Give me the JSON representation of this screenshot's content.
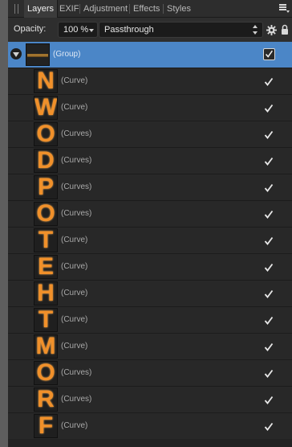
{
  "tabs": [
    {
      "label": "Layers",
      "active": true
    },
    {
      "label": "EXIF",
      "active": false
    },
    {
      "label": "Adjustment",
      "active": false
    },
    {
      "label": "Effects",
      "active": false
    },
    {
      "label": "Styles",
      "active": false
    }
  ],
  "toolbar": {
    "opacity_label": "Opacity:",
    "opacity_value": "100 %",
    "blend_mode": "Passthrough"
  },
  "group": {
    "name": "(Group)",
    "visible": true
  },
  "layers": [
    {
      "letter": "N",
      "name": "(Curve)",
      "visible": true
    },
    {
      "letter": "W",
      "name": "(Curve)",
      "visible": true
    },
    {
      "letter": "O",
      "name": "(Curves)",
      "visible": true
    },
    {
      "letter": "D",
      "name": "(Curves)",
      "visible": true
    },
    {
      "letter": "P",
      "name": "(Curves)",
      "visible": true
    },
    {
      "letter": "O",
      "name": "(Curves)",
      "visible": true
    },
    {
      "letter": "T",
      "name": "(Curve)",
      "visible": true
    },
    {
      "letter": "E",
      "name": "(Curve)",
      "visible": true
    },
    {
      "letter": "H",
      "name": "(Curve)",
      "visible": true
    },
    {
      "letter": "T",
      "name": "(Curve)",
      "visible": true
    },
    {
      "letter": "M",
      "name": "(Curve)",
      "visible": true
    },
    {
      "letter": "O",
      "name": "(Curves)",
      "visible": true
    },
    {
      "letter": "R",
      "name": "(Curves)",
      "visible": true
    },
    {
      "letter": "F",
      "name": "(Curve)",
      "visible": true
    }
  ],
  "icons": {
    "panel_menu": "panel-menu-icon",
    "grip": "grip-icon",
    "settings": "gear-icon",
    "lock": "lock-icon",
    "expander": "disclosure-triangle-icon",
    "visibility": "checkmark-icon"
  },
  "colors": {
    "selection": "#4b86c7",
    "letter_orange": "#f0902a",
    "panel_bg": "#282828"
  }
}
